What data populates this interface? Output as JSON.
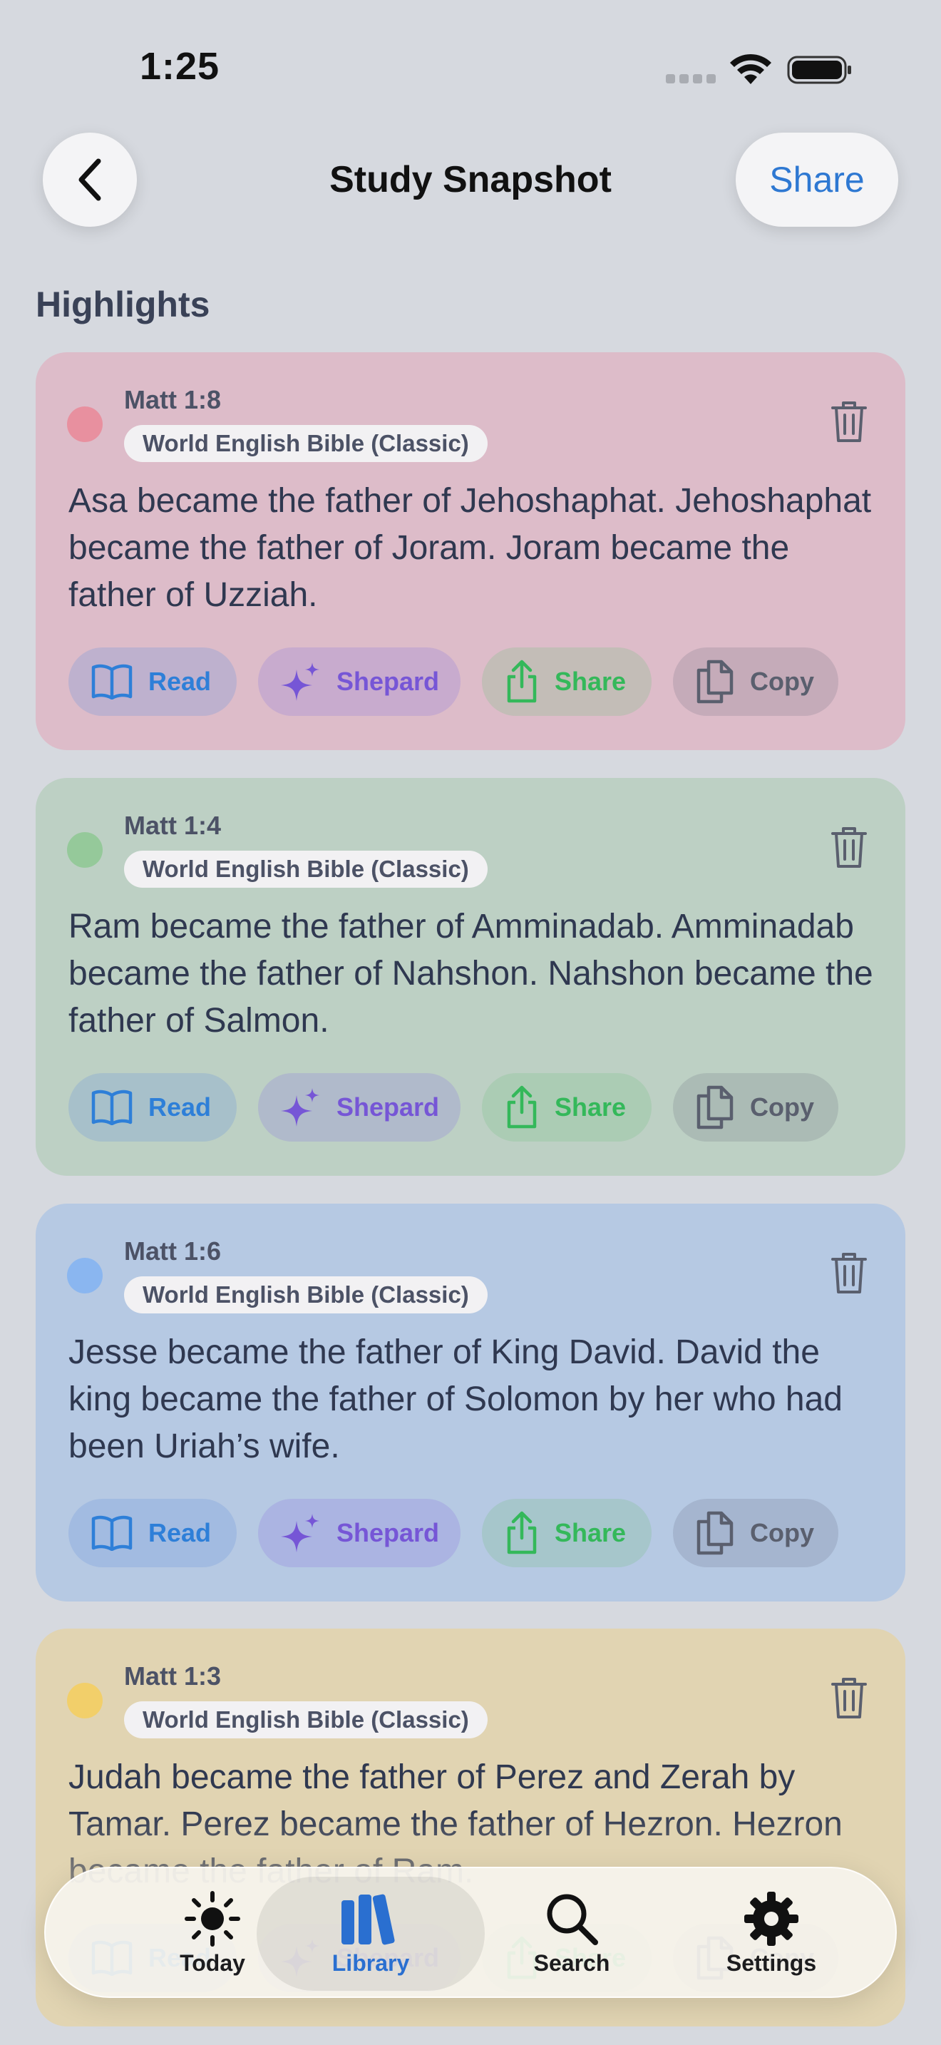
{
  "status": {
    "time": "1:25"
  },
  "nav": {
    "title": "Study Snapshot",
    "share_label": "Share"
  },
  "section_title": "Highlights",
  "highlights": [
    {
      "reference": "Matt 1:8",
      "version": "World English Bible (Classic)",
      "color": "#e8909f",
      "text": "Asa became the father of Jehoshaphat. Jehoshaphat became the father of Joram. Joram became the father of Uzziah."
    },
    {
      "reference": "Matt 1:4",
      "version": "World English Bible (Classic)",
      "color": "#95c99a",
      "text": "Ram became the father of Amminadab. Amminadab became the father of Nahshon. Nahshon became the father of Salmon."
    },
    {
      "reference": "Matt 1:6",
      "version": "World English Bible (Classic)",
      "color": "#8ab6f0",
      "text": "Jesse became the father of King David. David the king became the father of Solomon by her who had been Uriah’s wife."
    },
    {
      "reference": "Matt 1:3",
      "version": "World English Bible (Classic)",
      "color": "#f2cf6a",
      "text": "Judah became the father of Perez and Zerah by Tamar. Perez became the father of Hezron. Hezron became the father of Ram."
    }
  ],
  "actions": {
    "read": "Read",
    "shepard": "Shepard",
    "share": "Share",
    "copy": "Copy"
  },
  "colors": {
    "read": "#2e7fd8",
    "shepard": "#7656d6",
    "share": "#34b85a",
    "copy": "#5a5f6e",
    "tab_active": "#2a6fd0"
  },
  "tabs": [
    {
      "label": "Today",
      "icon": "sun-icon"
    },
    {
      "label": "Library",
      "icon": "books-icon",
      "active": true
    },
    {
      "label": "Search",
      "icon": "magnifier-icon"
    },
    {
      "label": "Settings",
      "icon": "gear-icon"
    }
  ]
}
